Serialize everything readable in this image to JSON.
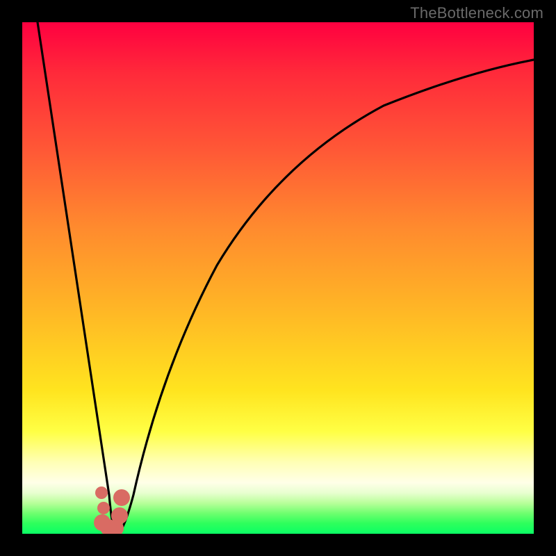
{
  "watermark": "TheBottleneck.com",
  "colors": {
    "frame": "#000000",
    "curve_line": "#000000",
    "marker": "#d96b63",
    "gradient_top": "#ff0040",
    "gradient_bottom": "#0bff65"
  },
  "chart_data": {
    "type": "line",
    "title": "",
    "xlabel": "",
    "ylabel": "",
    "xlim": [
      0,
      100
    ],
    "ylim": [
      0,
      100
    ],
    "grid": false,
    "legend": false,
    "series": [
      {
        "name": "bottleneck-curve",
        "x": [
          3,
          6,
          9,
          12,
          15,
          17,
          18,
          19,
          20,
          22,
          25,
          30,
          35,
          40,
          50,
          60,
          70,
          80,
          90,
          100
        ],
        "y": [
          100,
          80,
          60,
          40,
          20,
          6,
          0,
          2,
          6,
          20,
          38,
          56,
          66,
          73,
          82,
          86,
          89,
          91,
          92.5,
          93.5
        ]
      }
    ],
    "markers": [
      {
        "name": "marker-dot-a",
        "x": 15.5,
        "y": 8,
        "r": 1.2
      },
      {
        "name": "marker-dot-b",
        "x": 15.9,
        "y": 5,
        "r": 1.2
      },
      {
        "name": "marker-j-head",
        "x": 19.4,
        "y": 7,
        "r": 1.7
      },
      {
        "name": "marker-j-mid",
        "x": 19.0,
        "y": 3.5,
        "r": 1.7
      },
      {
        "name": "marker-j-foot1",
        "x": 18.2,
        "y": 1.0,
        "r": 1.7
      },
      {
        "name": "marker-j-foot2",
        "x": 16.8,
        "y": 1.2,
        "r": 1.7
      },
      {
        "name": "marker-j-foot3",
        "x": 15.6,
        "y": 2.2,
        "r": 1.7
      }
    ]
  }
}
